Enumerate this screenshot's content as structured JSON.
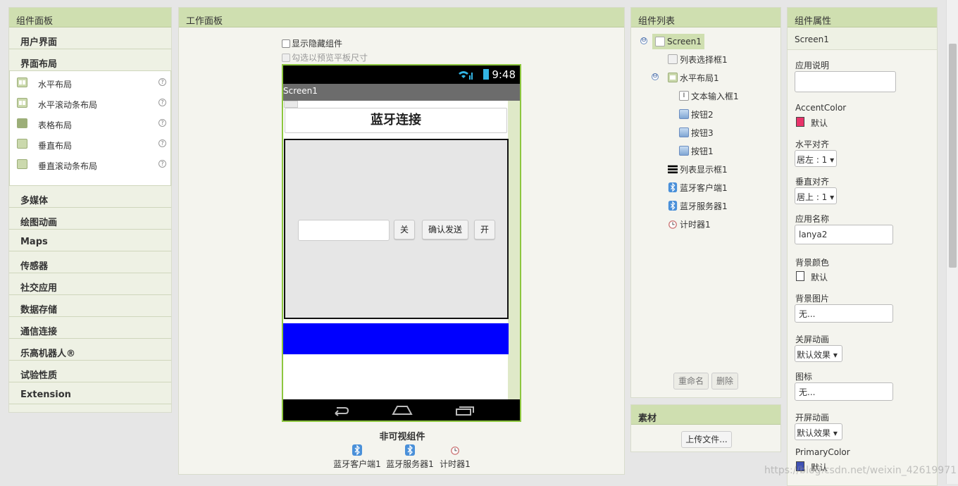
{
  "palette": {
    "title": "组件面板",
    "categories_top": [
      "用户界面",
      "界面布局"
    ],
    "layout_items": [
      {
        "label": "水平布局",
        "icon": "horizontal-arrangement-icon"
      },
      {
        "label": "水平滚动条布局",
        "icon": "horizontal-scroll-arrangement-icon"
      },
      {
        "label": "表格布局",
        "icon": "table-arrangement-icon"
      },
      {
        "label": "垂直布局",
        "icon": "vertical-arrangement-icon"
      },
      {
        "label": "垂直滚动条布局",
        "icon": "vertical-scroll-arrangement-icon"
      }
    ],
    "help": "?",
    "categories_bottom": [
      "多媒体",
      "绘图动画",
      "Maps",
      "传感器",
      "社交应用",
      "数据存储",
      "通信连接",
      "乐高机器人®",
      "试验性质",
      "Extension"
    ]
  },
  "workspace": {
    "title": "工作面板",
    "show_hidden": "显示隐藏组件",
    "tablet_preview": "勾选以预览平板尺寸",
    "phone": {
      "time": "9:48",
      "screen_title": "Screen1",
      "heading": "蓝牙连接",
      "btn_close": "关",
      "btn_send": "确认发送",
      "btn_open": "开",
      "listview_color": "#0000ff"
    },
    "nonvisible_title": "非可视组件",
    "nonvisible": [
      "蓝牙客户端1",
      "蓝牙服务器1",
      "计时器1"
    ]
  },
  "tree": {
    "title": "组件列表",
    "nodes": [
      "Screen1",
      "列表选择框1",
      "水平布局1",
      "文本输入框1",
      "按钮2",
      "按钮3",
      "按钮1",
      "列表显示框1",
      "蓝牙客户端1",
      "蓝牙服务器1",
      "计时器1"
    ],
    "collapse": "⊖",
    "rename": "重命名",
    "delete": "删除"
  },
  "media": {
    "title": "素材",
    "upload": "上传文件..."
  },
  "props": {
    "title": "组件属性",
    "component": "Screen1",
    "about_label": "应用说明",
    "accent_label": "AccentColor",
    "accent_value": "默认",
    "accent_color": "#e8336a",
    "halign_label": "水平对齐",
    "halign_value": "居左 : 1 ▾",
    "valign_label": "垂直对齐",
    "valign_value": "居上 : 1 ▾",
    "appname_label": "应用名称",
    "appname_value": "lanya2",
    "bgcolor_label": "背景颜色",
    "bgcolor_value": "默认",
    "bgimage_label": "背景图片",
    "bgimage_value": "无...",
    "close_anim_label": "关屏动画",
    "close_anim_value": "默认效果 ▾",
    "icon_label": "图标",
    "icon_value": "无...",
    "open_anim_label": "开屏动画",
    "open_anim_value": "默认效果 ▾",
    "primary_label": "PrimaryColor",
    "primary_value": "默认",
    "primary_color": "#3f51b5"
  },
  "watermark": "https://blog.csdn.net/weixin_42619971"
}
